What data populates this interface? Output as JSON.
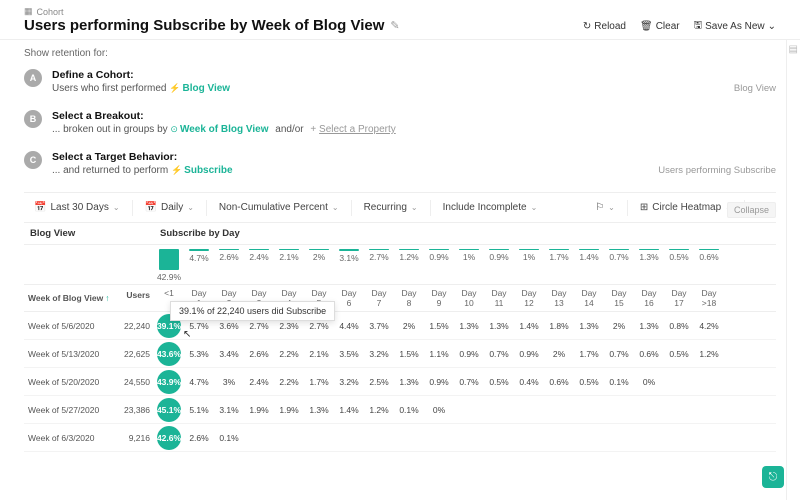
{
  "breadcrumb": {
    "icon": "cohort-icon",
    "label": "Cohort"
  },
  "title": "Users performing Subscribe by Week of Blog View",
  "actions": {
    "reload": "Reload",
    "clear": "Clear",
    "save_as_new": "Save As New"
  },
  "retention_label": "Show retention for:",
  "steps": {
    "a": {
      "letter": "A",
      "title": "Define a Cohort:",
      "desc_prefix": "Users who first performed",
      "event": "Blog View",
      "right": "Blog View"
    },
    "b": {
      "letter": "B",
      "title": "Select a Breakout:",
      "desc_prefix": "... broken out in groups by",
      "event": "Week of Blog View",
      "andor": "and/or",
      "prop_prefix": "+",
      "prop": "Select a Property"
    },
    "c": {
      "letter": "C",
      "title": "Select a Target Behavior:",
      "desc_prefix": "... and returned to perform",
      "event": "Subscribe",
      "right": "Users performing Subscribe"
    }
  },
  "collapse": "Collapse",
  "controls": {
    "range": "Last 30 Days",
    "interval": "Daily",
    "percent": "Non-Cumulative Percent",
    "recurring": "Recurring",
    "include_incomplete": "Include Incomplete",
    "heatmap": "Circle Heatmap"
  },
  "grid": {
    "left_header": "Blog View",
    "right_header": "Subscribe by Day",
    "week_col": "Week of Blog View",
    "users_col": "Users",
    "day_labels": [
      "<1",
      "Day 1",
      "Day 2",
      "Day 3",
      "Day 4",
      "Day 5",
      "Day 6",
      "Day 7",
      "Day 8",
      "Day 9",
      "Day 10",
      "Day 11",
      "Day 12",
      "Day 13",
      "Day 14",
      "Day 15",
      "Day 16",
      "Day 17",
      "Day >18"
    ],
    "sparkline": [
      "42.9%",
      "4.7%",
      "2.6%",
      "2.4%",
      "2.1%",
      "2%",
      "3.1%",
      "2.7%",
      "1.2%",
      "0.9%",
      "1%",
      "0.9%",
      "1%",
      "1.7%",
      "1.4%",
      "0.7%",
      "1.3%",
      "0.5%",
      "0.6%"
    ],
    "rows": [
      {
        "label": "Week of 5/6/2020",
        "users": "22,240",
        "vals": [
          "39.1%",
          "5.7%",
          "3.6%",
          "2.7%",
          "2.3%",
          "2.7%",
          "4.4%",
          "3.7%",
          "2%",
          "1.5%",
          "1.3%",
          "1.3%",
          "1.4%",
          "1.8%",
          "1.3%",
          "2%",
          "1.3%",
          "0.8%",
          "4.2%"
        ]
      },
      {
        "label": "Week of 5/13/2020",
        "users": "22,625",
        "vals": [
          "43.6%",
          "5.3%",
          "3.4%",
          "2.6%",
          "2.2%",
          "2.1%",
          "3.5%",
          "3.2%",
          "1.5%",
          "1.1%",
          "0.9%",
          "0.7%",
          "0.9%",
          "2%",
          "1.7%",
          "0.7%",
          "0.6%",
          "0.5%",
          "1.2%"
        ]
      },
      {
        "label": "Week of 5/20/2020",
        "users": "24,550",
        "vals": [
          "43.9%",
          "4.7%",
          "3%",
          "2.4%",
          "2.2%",
          "1.7%",
          "3.2%",
          "2.5%",
          "1.3%",
          "0.9%",
          "0.7%",
          "0.5%",
          "0.4%",
          "0.6%",
          "0.5%",
          "0.1%",
          "0%",
          "",
          ""
        ]
      },
      {
        "label": "Week of 5/27/2020",
        "users": "23,386",
        "vals": [
          "45.1%",
          "5.1%",
          "3.1%",
          "1.9%",
          "1.9%",
          "1.3%",
          "1.4%",
          "1.2%",
          "0.1%",
          "0%",
          "",
          "",
          "",
          "",
          "",
          "",
          "",
          "",
          ""
        ]
      },
      {
        "label": "Week of 6/3/2020",
        "users": "9,216",
        "vals": [
          "42.6%",
          "2.6%",
          "0.1%",
          "",
          "",
          "",
          "",
          "",
          "",
          "",
          "",
          "",
          "",
          "",
          "",
          "",
          "",
          "",
          ""
        ]
      }
    ]
  },
  "tooltip": "39.1% of 22,240 users did Subscribe",
  "chart_data": {
    "type": "heatmap",
    "title": "Users performing Subscribe by Week of Blog View",
    "xlabel": "Subscribe by Day",
    "ylabel": "Week of Blog View",
    "x": [
      "<1",
      "1",
      "2",
      "3",
      "4",
      "5",
      "6",
      "7",
      "8",
      "9",
      "10",
      "11",
      "12",
      "13",
      "14",
      "15",
      "16",
      "17",
      ">18"
    ],
    "series": [
      {
        "name": "Week of 5/6/2020",
        "users": 22240,
        "values": [
          39.1,
          5.7,
          3.6,
          2.7,
          2.3,
          2.7,
          4.4,
          3.7,
          2.0,
          1.5,
          1.3,
          1.3,
          1.4,
          1.8,
          1.3,
          2.0,
          1.3,
          0.8,
          4.2
        ]
      },
      {
        "name": "Week of 5/13/2020",
        "users": 22625,
        "values": [
          43.6,
          5.3,
          3.4,
          2.6,
          2.2,
          2.1,
          3.5,
          3.2,
          1.5,
          1.1,
          0.9,
          0.7,
          0.9,
          2.0,
          1.7,
          0.7,
          0.6,
          0.5,
          1.2
        ]
      },
      {
        "name": "Week of 5/20/2020",
        "users": 24550,
        "values": [
          43.9,
          4.7,
          3.0,
          2.4,
          2.2,
          1.7,
          3.2,
          2.5,
          1.3,
          0.9,
          0.7,
          0.5,
          0.4,
          0.6,
          0.5,
          0.1,
          0.0,
          null,
          null
        ]
      },
      {
        "name": "Week of 5/27/2020",
        "users": 23386,
        "values": [
          45.1,
          5.1,
          3.1,
          1.9,
          1.9,
          1.3,
          1.4,
          1.2,
          0.1,
          0.0,
          null,
          null,
          null,
          null,
          null,
          null,
          null,
          null,
          null
        ]
      },
      {
        "name": "Week of 6/3/2020",
        "users": 9216,
        "values": [
          42.6,
          2.6,
          0.1,
          null,
          null,
          null,
          null,
          null,
          null,
          null,
          null,
          null,
          null,
          null,
          null,
          null,
          null,
          null,
          null
        ]
      }
    ],
    "aggregate": [
      42.9,
      4.7,
      2.6,
      2.4,
      2.1,
      2.0,
      3.1,
      2.7,
      1.2,
      0.9,
      1.0,
      0.9,
      1.0,
      1.7,
      1.4,
      0.7,
      1.3,
      0.5,
      0.6
    ]
  }
}
